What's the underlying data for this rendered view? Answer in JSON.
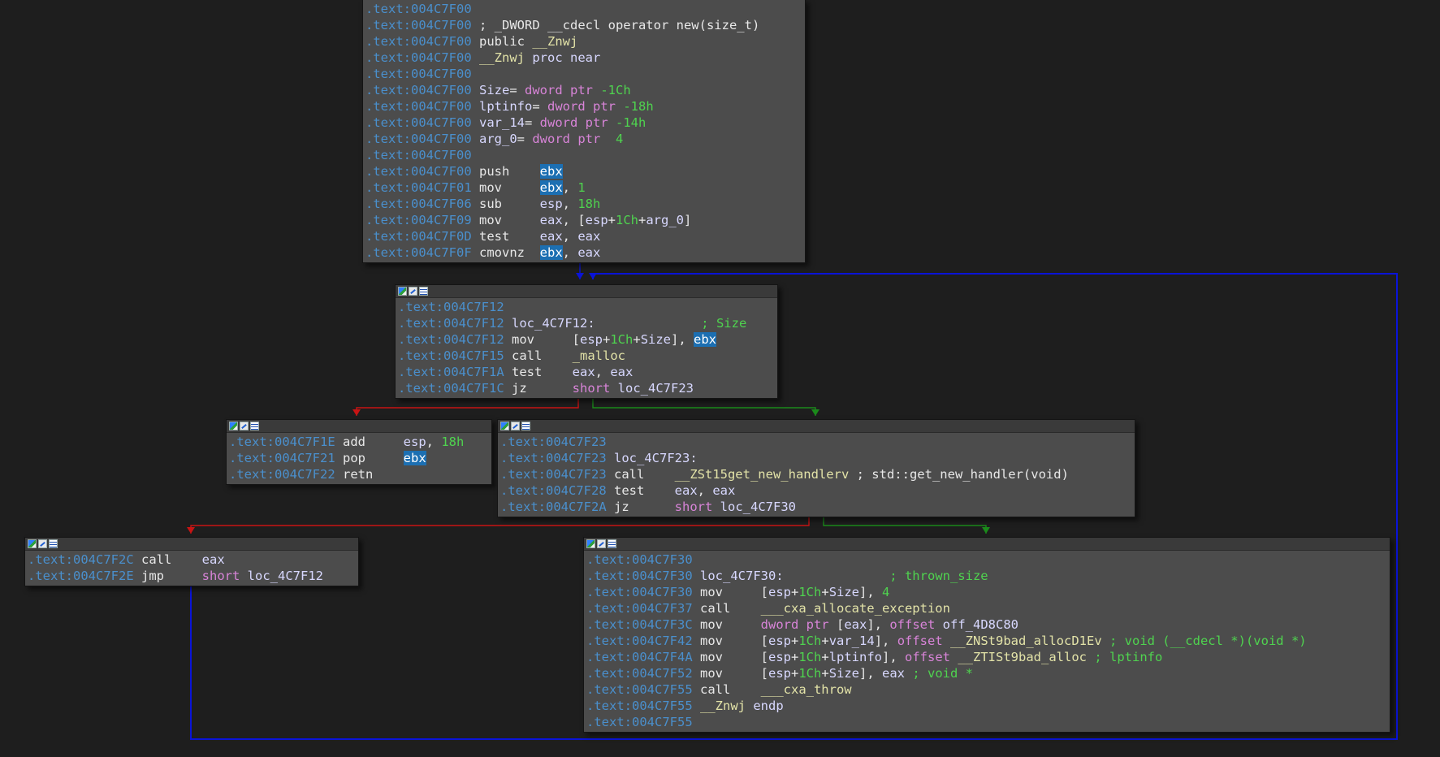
{
  "window": {
    "background": "#1e1e1e"
  },
  "colors": {
    "address": "#4a8fcc",
    "keyword": "#d884d8",
    "number": "#4fd34f",
    "comment": "#4fd34f",
    "function": "#e3e3a8",
    "highlight": "#1c6fb2",
    "edge_true": "#1b8a1b",
    "edge_false": "#c81414",
    "edge_loop": "#0a14d8"
  },
  "header_icons": [
    "graph-overview-icon",
    "graph-edit-icon",
    "text-view-icon"
  ],
  "blocks": [
    {
      "id": "block-entry",
      "has_header": false,
      "lines": [
        {
          "addr": ".text:004C7F00",
          "segs": []
        },
        {
          "addr": ".text:004C7F00",
          "segs": [
            {
              "t": "; _DWORD __cdecl operator new(size_t)",
              "c": "txt"
            }
          ]
        },
        {
          "addr": ".text:004C7F00",
          "segs": [
            {
              "t": "public ",
              "c": "txt"
            },
            {
              "t": "__Znwj",
              "c": "fn"
            }
          ]
        },
        {
          "addr": ".text:004C7F00",
          "segs": [
            {
              "t": "__Znwj",
              "c": "fn"
            },
            {
              "t": " proc near",
              "c": "lbl"
            }
          ]
        },
        {
          "addr": ".text:004C7F00",
          "segs": []
        },
        {
          "addr": ".text:004C7F00",
          "segs": [
            {
              "t": "Size",
              "c": "lbl"
            },
            {
              "t": "= ",
              "c": "txt"
            },
            {
              "t": "dword ptr",
              "c": "kw"
            },
            {
              "t": " -1Ch",
              "c": "num"
            }
          ]
        },
        {
          "addr": ".text:004C7F00",
          "segs": [
            {
              "t": "lptinfo",
              "c": "lbl"
            },
            {
              "t": "= ",
              "c": "txt"
            },
            {
              "t": "dword ptr",
              "c": "kw"
            },
            {
              "t": " -18h",
              "c": "num"
            }
          ]
        },
        {
          "addr": ".text:004C7F00",
          "segs": [
            {
              "t": "var_14",
              "c": "lbl"
            },
            {
              "t": "= ",
              "c": "txt"
            },
            {
              "t": "dword ptr",
              "c": "kw"
            },
            {
              "t": " -14h",
              "c": "num"
            }
          ]
        },
        {
          "addr": ".text:004C7F00",
          "segs": [
            {
              "t": "arg_0",
              "c": "lbl"
            },
            {
              "t": "= ",
              "c": "txt"
            },
            {
              "t": "dword ptr",
              "c": "kw"
            },
            {
              "t": "  4",
              "c": "num"
            }
          ]
        },
        {
          "addr": ".text:004C7F00",
          "segs": []
        },
        {
          "addr": ".text:004C7F00",
          "segs": [
            {
              "t": "push    ",
              "c": "txt"
            },
            {
              "t": "ebx",
              "c": "hl"
            }
          ]
        },
        {
          "addr": ".text:004C7F01",
          "segs": [
            {
              "t": "mov     ",
              "c": "txt"
            },
            {
              "t": "ebx",
              "c": "hl"
            },
            {
              "t": ", ",
              "c": "txt"
            },
            {
              "t": "1",
              "c": "num"
            }
          ]
        },
        {
          "addr": ".text:004C7F06",
          "segs": [
            {
              "t": "sub     ",
              "c": "txt"
            },
            {
              "t": "esp",
              "c": "reg"
            },
            {
              "t": ", ",
              "c": "txt"
            },
            {
              "t": "18h",
              "c": "num"
            }
          ]
        },
        {
          "addr": ".text:004C7F09",
          "segs": [
            {
              "t": "mov     ",
              "c": "txt"
            },
            {
              "t": "eax",
              "c": "reg"
            },
            {
              "t": ", [",
              "c": "txt"
            },
            {
              "t": "esp",
              "c": "reg"
            },
            {
              "t": "+",
              "c": "txt"
            },
            {
              "t": "1Ch",
              "c": "num"
            },
            {
              "t": "+",
              "c": "txt"
            },
            {
              "t": "arg_0",
              "c": "lbl"
            },
            {
              "t": "]",
              "c": "txt"
            }
          ]
        },
        {
          "addr": ".text:004C7F0D",
          "segs": [
            {
              "t": "test    ",
              "c": "txt"
            },
            {
              "t": "eax",
              "c": "reg"
            },
            {
              "t": ", ",
              "c": "txt"
            },
            {
              "t": "eax",
              "c": "reg"
            }
          ]
        },
        {
          "addr": ".text:004C7F0F",
          "segs": [
            {
              "t": "cmovnz  ",
              "c": "txt"
            },
            {
              "t": "ebx",
              "c": "hl"
            },
            {
              "t": ", ",
              "c": "txt"
            },
            {
              "t": "eax",
              "c": "reg"
            }
          ]
        }
      ]
    },
    {
      "id": "block-loc-4c7f12",
      "has_header": true,
      "lines": [
        {
          "addr": ".text:004C7F12",
          "segs": []
        },
        {
          "addr": ".text:004C7F12",
          "segs": [
            {
              "t": "loc_4C7F12:",
              "c": "lbl"
            },
            {
              "t": "              ; Size",
              "c": "cmt"
            }
          ]
        },
        {
          "addr": ".text:004C7F12",
          "segs": [
            {
              "t": "mov     ",
              "c": "txt"
            },
            {
              "t": "[",
              "c": "txt"
            },
            {
              "t": "esp",
              "c": "reg"
            },
            {
              "t": "+",
              "c": "txt"
            },
            {
              "t": "1Ch",
              "c": "num"
            },
            {
              "t": "+",
              "c": "txt"
            },
            {
              "t": "Size",
              "c": "lbl"
            },
            {
              "t": "], ",
              "c": "txt"
            },
            {
              "t": "ebx",
              "c": "hl"
            }
          ]
        },
        {
          "addr": ".text:004C7F15",
          "segs": [
            {
              "t": "call    ",
              "c": "txt"
            },
            {
              "t": "_malloc",
              "c": "fn"
            }
          ]
        },
        {
          "addr": ".text:004C7F1A",
          "segs": [
            {
              "t": "test    ",
              "c": "txt"
            },
            {
              "t": "eax",
              "c": "reg"
            },
            {
              "t": ", ",
              "c": "txt"
            },
            {
              "t": "eax",
              "c": "reg"
            }
          ]
        },
        {
          "addr": ".text:004C7F1C",
          "segs": [
            {
              "t": "jz      ",
              "c": "txt"
            },
            {
              "t": "short",
              "c": "kw"
            },
            {
              "t": " loc_4C7F23",
              "c": "lbl"
            }
          ]
        }
      ]
    },
    {
      "id": "block-return",
      "has_header": true,
      "lines": [
        {
          "addr": ".text:004C7F1E",
          "segs": [
            {
              "t": "add     ",
              "c": "txt"
            },
            {
              "t": "esp",
              "c": "reg"
            },
            {
              "t": ", ",
              "c": "txt"
            },
            {
              "t": "18h",
              "c": "num"
            }
          ]
        },
        {
          "addr": ".text:004C7F21",
          "segs": [
            {
              "t": "pop     ",
              "c": "txt"
            },
            {
              "t": "ebx",
              "c": "hl"
            }
          ]
        },
        {
          "addr": ".text:004C7F22",
          "segs": [
            {
              "t": "retn",
              "c": "txt"
            }
          ]
        }
      ]
    },
    {
      "id": "block-loc-4c7f23",
      "has_header": true,
      "lines": [
        {
          "addr": ".text:004C7F23",
          "segs": []
        },
        {
          "addr": ".text:004C7F23",
          "segs": [
            {
              "t": "loc_4C7F23:",
              "c": "lbl"
            }
          ]
        },
        {
          "addr": ".text:004C7F23",
          "segs": [
            {
              "t": "call    ",
              "c": "txt"
            },
            {
              "t": "__ZSt15get_new_handlerv",
              "c": "fn"
            },
            {
              "t": " ; std::get_new_handler(void)",
              "c": "txt"
            }
          ]
        },
        {
          "addr": ".text:004C7F28",
          "segs": [
            {
              "t": "test    ",
              "c": "txt"
            },
            {
              "t": "eax",
              "c": "reg"
            },
            {
              "t": ", ",
              "c": "txt"
            },
            {
              "t": "eax",
              "c": "reg"
            }
          ]
        },
        {
          "addr": ".text:004C7F2A",
          "segs": [
            {
              "t": "jz      ",
              "c": "txt"
            },
            {
              "t": "short",
              "c": "kw"
            },
            {
              "t": " loc_4C7F30",
              "c": "lbl"
            }
          ]
        }
      ]
    },
    {
      "id": "block-call-handler",
      "has_header": true,
      "lines": [
        {
          "addr": ".text:004C7F2C",
          "segs": [
            {
              "t": "call    ",
              "c": "txt"
            },
            {
              "t": "eax",
              "c": "reg"
            }
          ]
        },
        {
          "addr": ".text:004C7F2E",
          "segs": [
            {
              "t": "jmp     ",
              "c": "txt"
            },
            {
              "t": "short",
              "c": "kw"
            },
            {
              "t": " loc_4C7F12",
              "c": "lbl"
            }
          ]
        }
      ]
    },
    {
      "id": "block-loc-4c7f30",
      "has_header": true,
      "lines": [
        {
          "addr": ".text:004C7F30",
          "segs": []
        },
        {
          "addr": ".text:004C7F30",
          "segs": [
            {
              "t": "loc_4C7F30:",
              "c": "lbl"
            },
            {
              "t": "              ; thrown_size",
              "c": "cmt"
            }
          ]
        },
        {
          "addr": ".text:004C7F30",
          "segs": [
            {
              "t": "mov     ",
              "c": "txt"
            },
            {
              "t": "[",
              "c": "txt"
            },
            {
              "t": "esp",
              "c": "reg"
            },
            {
              "t": "+",
              "c": "txt"
            },
            {
              "t": "1Ch",
              "c": "num"
            },
            {
              "t": "+",
              "c": "txt"
            },
            {
              "t": "Size",
              "c": "lbl"
            },
            {
              "t": "], ",
              "c": "txt"
            },
            {
              "t": "4",
              "c": "num"
            }
          ]
        },
        {
          "addr": ".text:004C7F37",
          "segs": [
            {
              "t": "call    ",
              "c": "txt"
            },
            {
              "t": "___cxa_allocate_exception",
              "c": "fn"
            }
          ]
        },
        {
          "addr": ".text:004C7F3C",
          "segs": [
            {
              "t": "mov     ",
              "c": "txt"
            },
            {
              "t": "dword ptr",
              "c": "kw"
            },
            {
              "t": " [",
              "c": "txt"
            },
            {
              "t": "eax",
              "c": "reg"
            },
            {
              "t": "], ",
              "c": "txt"
            },
            {
              "t": "offset",
              "c": "kw"
            },
            {
              "t": " off_4D8C80",
              "c": "lbl"
            }
          ]
        },
        {
          "addr": ".text:004C7F42",
          "segs": [
            {
              "t": "mov     ",
              "c": "txt"
            },
            {
              "t": "[",
              "c": "txt"
            },
            {
              "t": "esp",
              "c": "reg"
            },
            {
              "t": "+",
              "c": "txt"
            },
            {
              "t": "1Ch",
              "c": "num"
            },
            {
              "t": "+",
              "c": "txt"
            },
            {
              "t": "var_14",
              "c": "lbl"
            },
            {
              "t": "], ",
              "c": "txt"
            },
            {
              "t": "offset",
              "c": "kw"
            },
            {
              "t": " __ZNSt9bad_allocD1Ev",
              "c": "fn"
            },
            {
              "t": " ; void (__cdecl *)(void *)",
              "c": "cmt"
            }
          ]
        },
        {
          "addr": ".text:004C7F4A",
          "segs": [
            {
              "t": "mov     ",
              "c": "txt"
            },
            {
              "t": "[",
              "c": "txt"
            },
            {
              "t": "esp",
              "c": "reg"
            },
            {
              "t": "+",
              "c": "txt"
            },
            {
              "t": "1Ch",
              "c": "num"
            },
            {
              "t": "+",
              "c": "txt"
            },
            {
              "t": "lptinfo",
              "c": "lbl"
            },
            {
              "t": "], ",
              "c": "txt"
            },
            {
              "t": "offset",
              "c": "kw"
            },
            {
              "t": " __ZTISt9bad_alloc",
              "c": "fn"
            },
            {
              "t": " ; lptinfo",
              "c": "cmt"
            }
          ]
        },
        {
          "addr": ".text:004C7F52",
          "segs": [
            {
              "t": "mov     ",
              "c": "txt"
            },
            {
              "t": "[",
              "c": "txt"
            },
            {
              "t": "esp",
              "c": "reg"
            },
            {
              "t": "+",
              "c": "txt"
            },
            {
              "t": "1Ch",
              "c": "num"
            },
            {
              "t": "+",
              "c": "txt"
            },
            {
              "t": "Size",
              "c": "lbl"
            },
            {
              "t": "], ",
              "c": "txt"
            },
            {
              "t": "eax",
              "c": "reg"
            },
            {
              "t": " ; void *",
              "c": "cmt"
            }
          ]
        },
        {
          "addr": ".text:004C7F55",
          "segs": [
            {
              "t": "call    ",
              "c": "txt"
            },
            {
              "t": "___cxa_throw",
              "c": "fn"
            }
          ]
        },
        {
          "addr": ".text:004C7F55",
          "segs": [
            {
              "t": "__Znwj",
              "c": "fn"
            },
            {
              "t": " endp",
              "c": "lbl"
            }
          ]
        },
        {
          "addr": ".text:004C7F55",
          "segs": []
        }
      ]
    }
  ],
  "edges": [
    {
      "id": "edge-entry-to-loop",
      "from": "block-entry",
      "to": "block-loc-4c7f12",
      "kind": "flow"
    },
    {
      "id": "edge-malloc-ok",
      "from": "block-loc-4c7f12",
      "to": "block-return",
      "kind": "false"
    },
    {
      "id": "edge-malloc-null",
      "from": "block-loc-4c7f12",
      "to": "block-loc-4c7f23",
      "kind": "true"
    },
    {
      "id": "edge-handler-present",
      "from": "block-loc-4c7f23",
      "to": "block-call-handler",
      "kind": "false"
    },
    {
      "id": "edge-handler-null",
      "from": "block-loc-4c7f23",
      "to": "block-loc-4c7f30",
      "kind": "true"
    },
    {
      "id": "edge-retry-loop",
      "from": "block-call-handler",
      "to": "block-loc-4c7f12",
      "kind": "loop"
    }
  ]
}
